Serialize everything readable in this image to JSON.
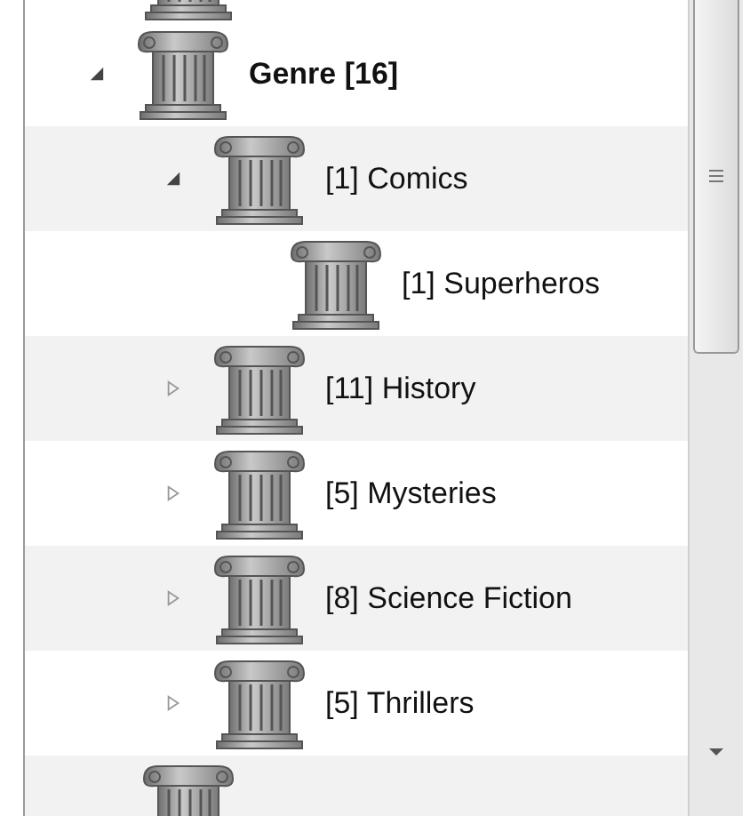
{
  "tree": [
    {
      "label": "Genre [16]",
      "bold": true,
      "expanded": true,
      "children": [
        {
          "label": "[1] Comics",
          "expanded": true,
          "children": [
            {
              "label": "[1] Superheros"
            }
          ]
        },
        {
          "label": "[11] History",
          "expanded": false
        },
        {
          "label": "[5] Mysteries",
          "expanded": false
        },
        {
          "label": "[8] Science Fiction",
          "expanded": false
        },
        {
          "label": "[5] Thrillers",
          "expanded": false
        }
      ]
    }
  ]
}
